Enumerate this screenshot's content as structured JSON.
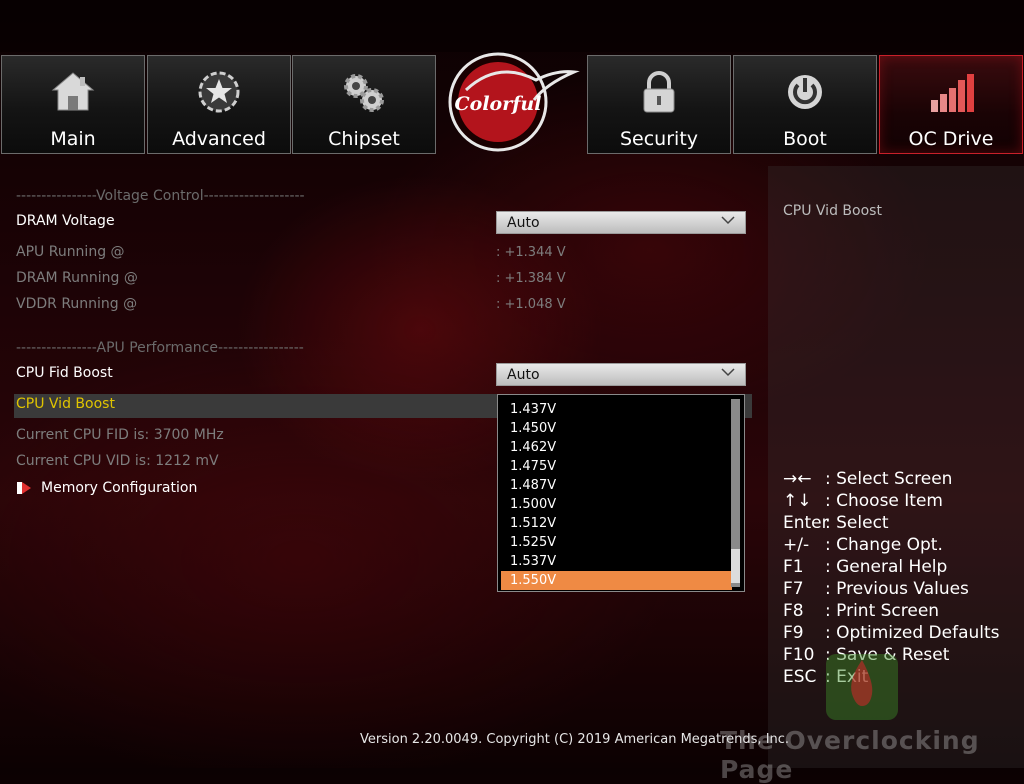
{
  "tabs": [
    {
      "label": "Main",
      "icon": "house-icon"
    },
    {
      "label": "Advanced",
      "icon": "star-gear-icon"
    },
    {
      "label": "Chipset",
      "icon": "gears-icon"
    },
    {
      "label": "Security",
      "icon": "padlock-icon"
    },
    {
      "label": "Boot",
      "icon": "power-icon"
    },
    {
      "label": "OC Drive",
      "icon": "bar-chart-icon"
    }
  ],
  "logo_text": "Colorful",
  "voltage_section": {
    "header": "----------------Voltage Control--------------------",
    "dram_voltage_label": "DRAM Voltage",
    "dram_voltage_value": "Auto",
    "apu_running_label": "APU  Running @",
    "apu_running_value": ": +1.344 V",
    "dram_running_label": "DRAM Running @",
    "dram_running_value": ": +1.384 V",
    "vddr_running_label": "VDDR Running @",
    "vddr_running_value": ": +1.048 V"
  },
  "apu_section": {
    "header": "----------------APU Performance-----------------",
    "cpu_fid_boost_label": "CPU Fid Boost",
    "cpu_fid_boost_value": "Auto",
    "cpu_vid_boost_label": "CPU Vid Boost",
    "current_fid": "Current CPU FID is: 3700 MHz",
    "current_vid": "Current CPU VID is: 1212 mV",
    "memory_config_label": "Memory Configuration"
  },
  "dropdown": {
    "options": [
      "1.437V",
      "1.450V",
      "1.462V",
      "1.475V",
      "1.487V",
      "1.500V",
      "1.512V",
      "1.525V",
      "1.537V",
      "1.550V"
    ],
    "selected": "1.550V"
  },
  "help": {
    "title": "CPU Vid Boost",
    "keys": [
      {
        "key": "→←",
        "desc": ": Select Screen"
      },
      {
        "key": "↑↓",
        "desc": ": Choose Item"
      },
      {
        "key": "Enter",
        "desc": ": Select"
      },
      {
        "key": "+/-",
        "desc": ": Change Opt."
      },
      {
        "key": "F1",
        "desc": ": General Help"
      },
      {
        "key": "F7",
        "desc": ": Previous Values"
      },
      {
        "key": "F8",
        "desc": ": Print Screen"
      },
      {
        "key": "F9",
        "desc": ": Optimized Defaults"
      },
      {
        "key": "F10",
        "desc": ": Save & Reset"
      },
      {
        "key": "ESC",
        "desc": ": Exit"
      }
    ]
  },
  "footer": "Version 2.20.0049. Copyright (C) 2019 American Megatrends, Inc.",
  "watermark": "The Overclocking Page",
  "colors": {
    "accent": "#c9202a",
    "selected_option": "#ef8a44",
    "highlight_text": "#e0c400"
  }
}
